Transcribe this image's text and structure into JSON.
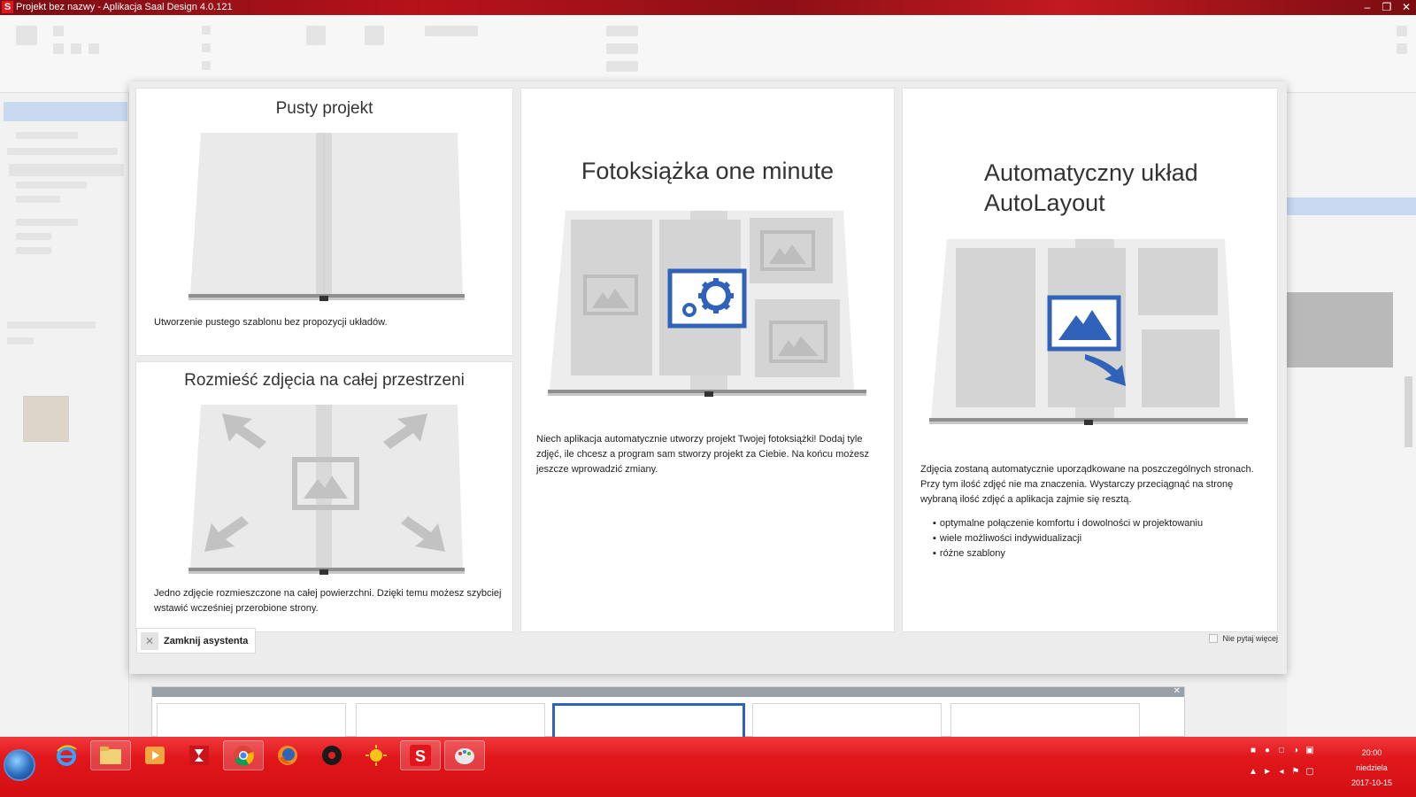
{
  "window": {
    "title": "Projekt bez nazwy - Aplikacja Saal Design 4.0.121",
    "logo_letter": "S",
    "minimize": "–",
    "maximize": "❐",
    "close": "✕"
  },
  "wizard": {
    "panels": {
      "empty": {
        "title": "Pusty projekt",
        "description": "Utworzenie pustego szablonu bez propozycji układów."
      },
      "fill": {
        "title": "Rozmieść zdjęcia na całej przestrzeni",
        "description": "Jedno zdjęcie rozmieszczone na całej powierzchni. Dzięki temu możesz szybciej wstawić wcześniej przerobione strony."
      },
      "oneminute": {
        "title": "Fotoksiążka one minute",
        "description": "Niech aplikacja automatycznie utworzy projekt Twojej fotoksiążki! Dodaj tyle zdjęć, ile chcesz a program sam stworzy projekt za Ciebie. Na końcu możesz jeszcze wprowadzić zmiany."
      },
      "autolayout": {
        "title": "Automatyczny układ AutoLayout",
        "description": "Zdjęcia zostaną automatycznie uporządkowane na poszczególnych stronach. Przy tym ilość zdjęć nie ma znaczenia. Wystarczy przeciągnąć na stronę wybraną ilość zdjęć a aplikacja zajmie się resztą.",
        "features": [
          "optymalne połączenie komfortu i dowolności w projektowaniu",
          "wiele możliwości indywidualizacji",
          "różne szablony"
        ]
      }
    },
    "close_button": "Zamknij asystenta",
    "close_icon": "✕",
    "dont_ask": "Nie pytaj więcej"
  },
  "filmstrip": {
    "close_icon": "✕"
  },
  "taskbar": {
    "pinned_apps": [
      "internet-explorer",
      "file-explorer",
      "media-player",
      "zynga",
      "chrome",
      "firefox",
      "obs",
      "sun-app",
      "saal-design",
      "paint"
    ],
    "clock": {
      "time": "20:00",
      "day": "niedziela",
      "date": "2017-10-15"
    }
  },
  "colors": {
    "accent_blue": "#2f62b8",
    "taskbar_red": "#e0171b",
    "titlebar_red": "#b8121b"
  }
}
